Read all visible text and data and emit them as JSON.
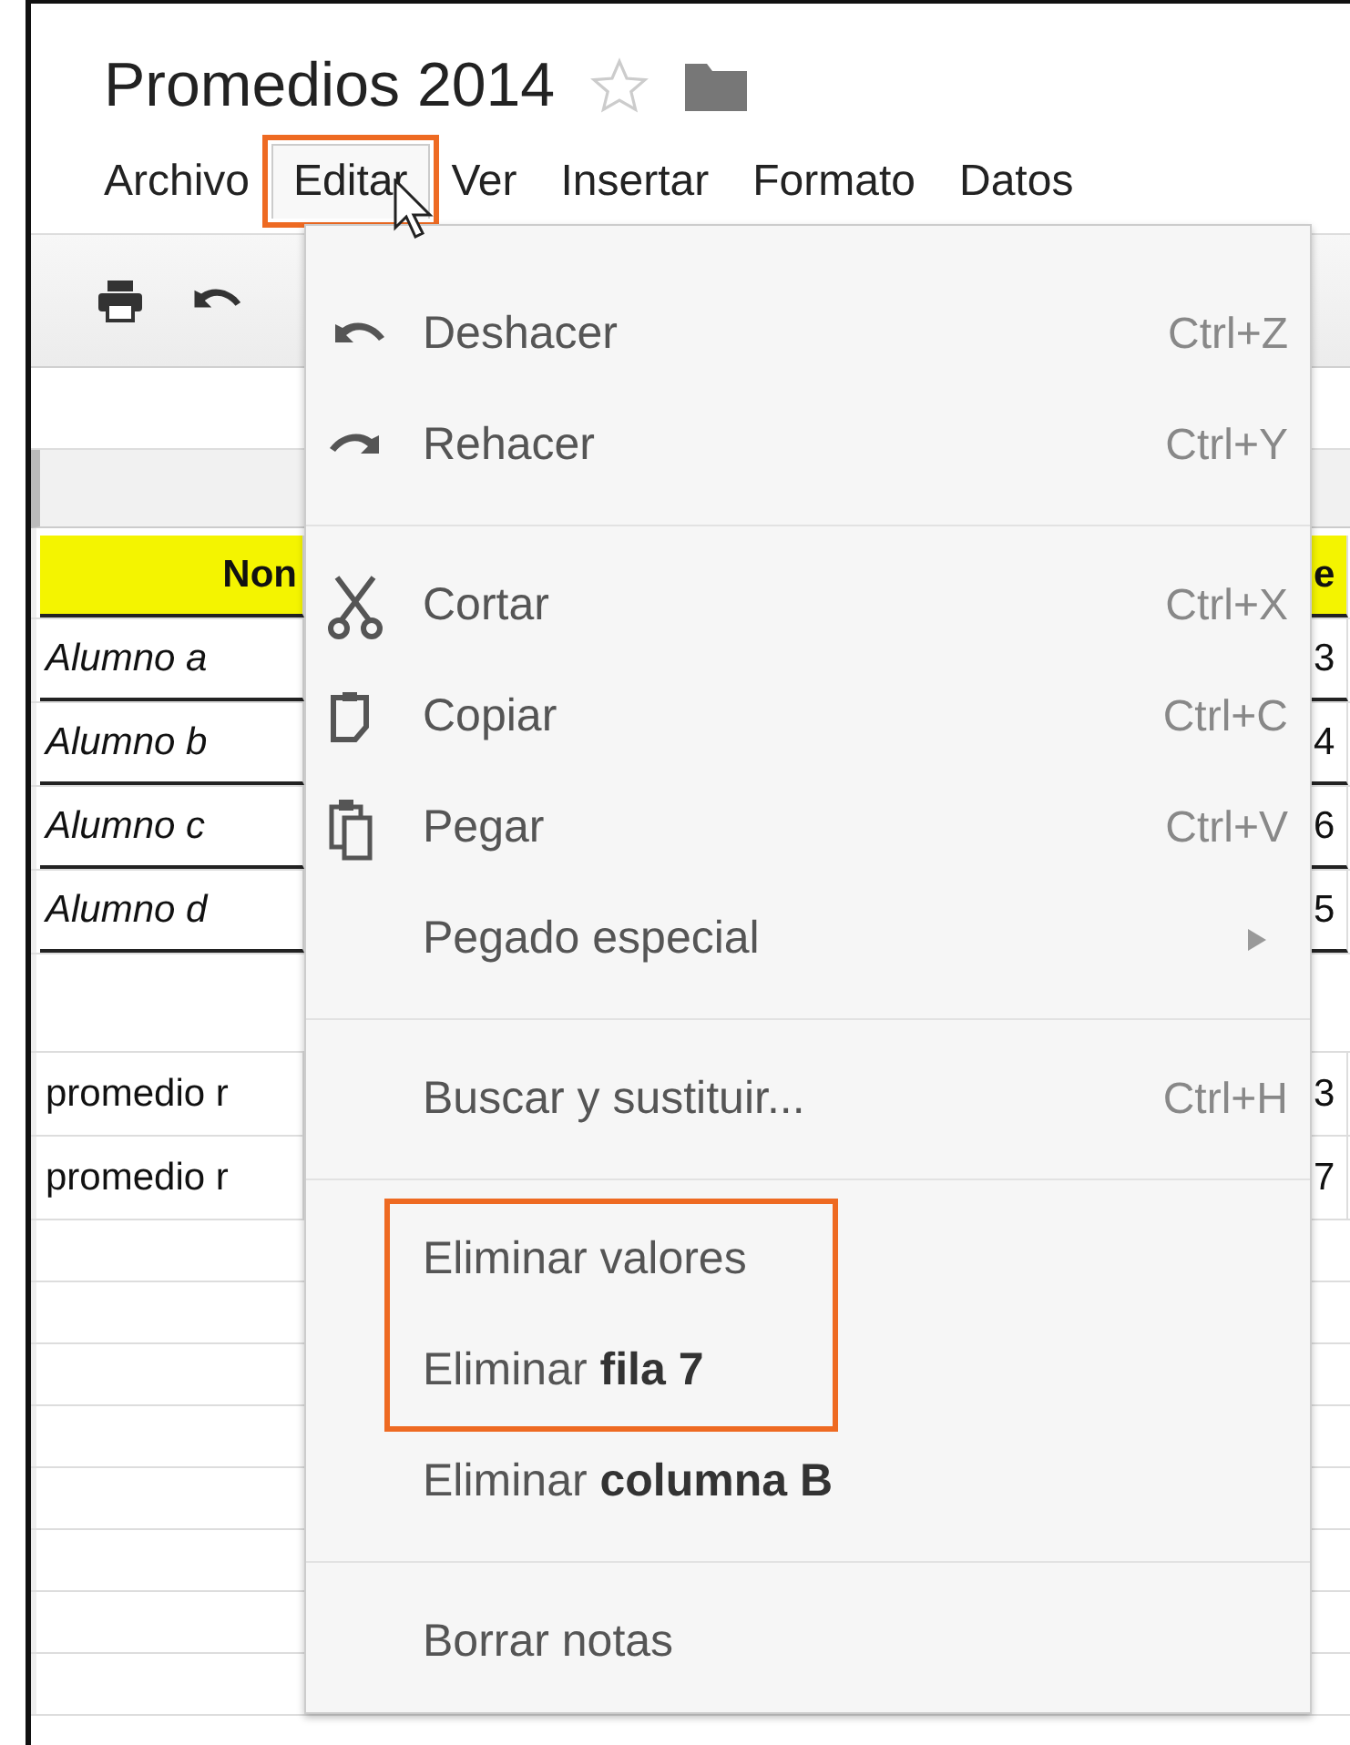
{
  "document": {
    "title": "Promedios 2014",
    "starred": false
  },
  "menu_bar": [
    {
      "label": "Archivo",
      "open": false,
      "highlighted": false
    },
    {
      "label": "Editar",
      "open": true,
      "highlighted": true
    },
    {
      "label": "Ver",
      "open": false,
      "highlighted": false
    },
    {
      "label": "Insertar",
      "open": false,
      "highlighted": false
    },
    {
      "label": "Formato",
      "open": false,
      "highlighted": false
    },
    {
      "label": "Datos",
      "open": false,
      "highlighted": false
    }
  ],
  "sheet": {
    "rows": [
      {
        "kind": "header",
        "cells": [
          "Non",
          "e"
        ]
      },
      {
        "kind": "name",
        "cells": [
          "Alumno a",
          "3"
        ]
      },
      {
        "kind": "name",
        "cells": [
          "Alumno b",
          "4"
        ]
      },
      {
        "kind": "name",
        "cells": [
          "Alumno c",
          "6"
        ]
      },
      {
        "kind": "name",
        "cells": [
          "Alumno d",
          "5"
        ]
      },
      {
        "kind": "blank",
        "cells": []
      },
      {
        "kind": "plain",
        "cells": [
          "promedio r",
          "3"
        ]
      },
      {
        "kind": "plain",
        "cells": [
          "promedio r",
          "7"
        ]
      }
    ]
  },
  "edit_menu": {
    "sections": [
      {
        "blocks": [
          {
            "highlighted": false,
            "items": [
              {
                "kind": "undo",
                "label": "Deshacer",
                "shortcut": "Ctrl+Z",
                "submenu": false
              },
              {
                "kind": "redo",
                "label": "Rehacer",
                "shortcut": "Ctrl+Y",
                "submenu": false
              }
            ]
          }
        ]
      },
      {
        "blocks": [
          {
            "highlighted": false,
            "items": [
              {
                "kind": "cut",
                "label": "Cortar",
                "shortcut": "Ctrl+X",
                "submenu": false
              },
              {
                "kind": "copy",
                "label": "Copiar",
                "shortcut": "Ctrl+C",
                "submenu": false
              },
              {
                "kind": "paste",
                "label": "Pegar",
                "shortcut": "Ctrl+V",
                "submenu": false
              },
              {
                "kind": "text",
                "label": "Pegado especial",
                "submenu": true
              }
            ]
          }
        ]
      },
      {
        "blocks": [
          {
            "highlighted": false,
            "items": [
              {
                "kind": "text",
                "label": "Buscar y sustituir...",
                "shortcut": "Ctrl+H",
                "submenu": false
              }
            ]
          }
        ]
      },
      {
        "blocks": [
          {
            "highlighted": true,
            "items": [
              {
                "kind": "text",
                "label": "Eliminar valores",
                "submenu": false
              },
              {
                "kind": "text",
                "label": "Eliminar **fila 7**",
                "submenu": false
              }
            ]
          },
          {
            "highlighted": false,
            "items": [
              {
                "kind": "text",
                "label": "Eliminar **columna B**",
                "submenu": false
              }
            ]
          }
        ]
      },
      {
        "blocks": [
          {
            "highlighted": false,
            "items": [
              {
                "kind": "text",
                "label": "Borrar notas",
                "submenu": false
              }
            ]
          }
        ]
      }
    ]
  }
}
